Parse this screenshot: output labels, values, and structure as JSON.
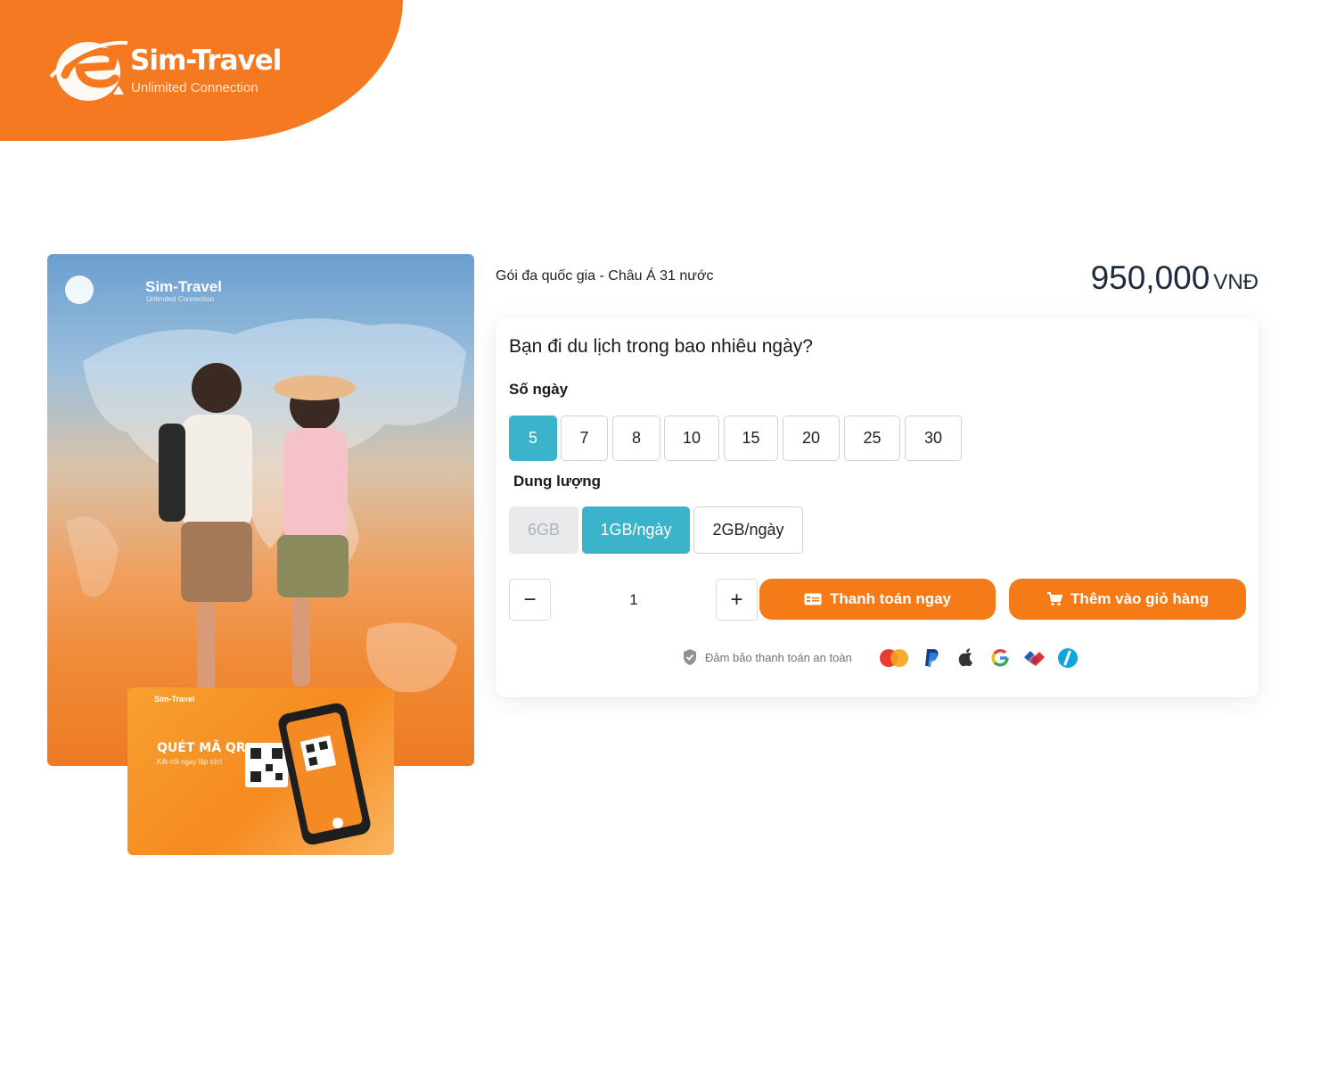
{
  "header": {
    "logo_title": "Sim-Travel",
    "logo_subtitle": "Unlimited Connection"
  },
  "product_image": {
    "logo_title": "Sim-Travel",
    "logo_subtitle": "Unlimited Connection",
    "qr_card": {
      "brand": "Sim-Travel",
      "title": "QUÉT MÃ QR",
      "subtitle": "Kết nối ngay lập tức!"
    }
  },
  "product": {
    "name": "Gói đa quốc gia - Châu Á 31 nước",
    "price": "950,000",
    "currency": "VNĐ"
  },
  "config": {
    "question": "Bạn đi du lịch trong bao nhiêu ngày?",
    "days_label": "Số ngày",
    "days": [
      "5",
      "7",
      "8",
      "10",
      "15",
      "20",
      "25",
      "30"
    ],
    "days_selected": "5",
    "data_label": "Dung lượng",
    "data_options": [
      {
        "label": "6GB",
        "state": "disabled"
      },
      {
        "label": "1GB/ngày",
        "state": "selected"
      },
      {
        "label": "2GB/ngày",
        "state": "normal"
      }
    ]
  },
  "quantity": {
    "minus": "−",
    "value": "1",
    "plus": "+"
  },
  "actions": {
    "buy_now": "Thanh toán ngay",
    "add_to_cart": "Thêm vào giỏ hàng"
  },
  "secure": {
    "text": "Đảm bảo thanh toán an toàn",
    "payment_icons": [
      "mastercard-icon",
      "paypal-icon",
      "apple-icon",
      "google-icon",
      "vnpay-icon",
      "zalopay-icon"
    ]
  },
  "colors": {
    "brand_orange": "#f47920",
    "accent_teal": "#3ab3cb",
    "price_navy": "#1d2b3f"
  }
}
